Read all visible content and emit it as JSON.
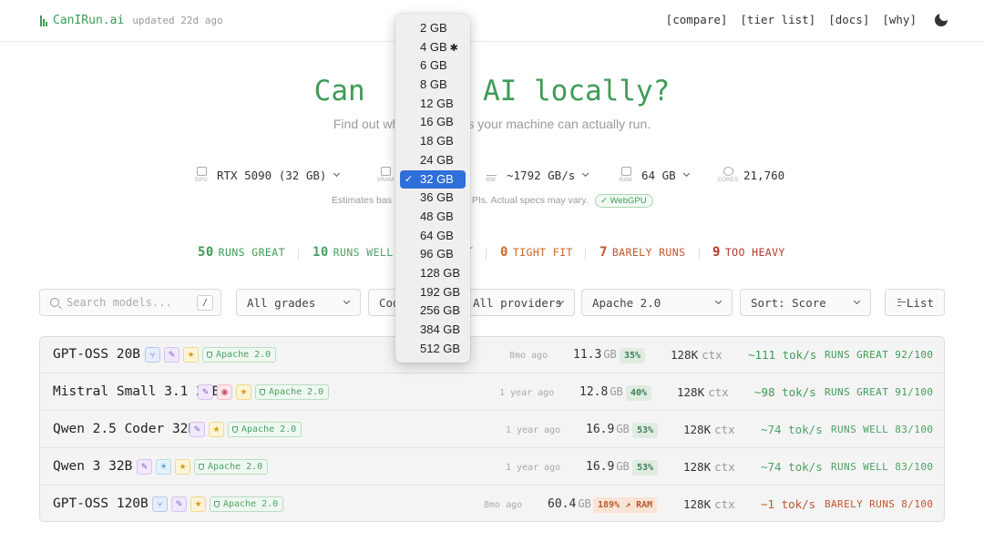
{
  "header": {
    "brand": "CanIRun.ai",
    "updated": "updated 22d ago",
    "nav": [
      "[compare]",
      "[tier list]",
      "[docs]",
      "[why]"
    ],
    "theme_icon": "moon-icon"
  },
  "hero": {
    "title_left": "Can",
    "title_right": "n AI locally?",
    "subtitle_left": "Find out whi",
    "subtitle_right": "s your machine can actually run."
  },
  "specs": {
    "gpu": {
      "label": "GPU",
      "value": "RTX 5090 (32 GB)"
    },
    "vram": {
      "label": "VRAM"
    },
    "bw": {
      "label": "BW",
      "value": "~1792 GB/s"
    },
    "ram": {
      "label": "RAM",
      "value": "64 GB"
    },
    "cores": {
      "label": "CORES",
      "value": "21,760"
    },
    "note_left": "Estimates bas",
    "note_right": "PIs. Actual specs may vary.",
    "webgpu": "WebGPU"
  },
  "counts": [
    {
      "num": "50",
      "label": "RUNS GREAT"
    },
    {
      "num": "10",
      "label": "RUNS WELL"
    },
    {
      "num": "",
      "label": "T"
    },
    {
      "num": "0",
      "label": "TIGHT FIT"
    },
    {
      "num": "7",
      "label": "BARELY RUNS"
    },
    {
      "num": "9",
      "label": "TOO HEAVY"
    }
  ],
  "filters": {
    "search_placeholder": "Search models...",
    "search_shortcut": "/",
    "grades": "All grades",
    "code_partial": "Cod",
    "providers": "All providers",
    "license": "Apache 2.0",
    "sort": "Sort: Score",
    "view": "List"
  },
  "models": [
    {
      "name": "GPT-OSS 20B",
      "badges": [
        "moe",
        "tool",
        "star"
      ],
      "license": "Apache 2.0",
      "age": "8mo ago",
      "size": "11.3",
      "unit": "GB",
      "pct": "35%",
      "ctx": "128K",
      "ctx_unit": "ctx",
      "speed": "~111 tok/s",
      "verdict": "RUNS GREAT 92/100"
    },
    {
      "name": "Mistral Small 3.1 24B",
      "badges": [
        "tool",
        "vision",
        "star"
      ],
      "license": "Apache 2.0",
      "age": "1 year ago",
      "size": "12.8",
      "unit": "GB",
      "pct": "40%",
      "ctx": "128K",
      "ctx_unit": "ctx",
      "speed": "~98 tok/s",
      "verdict": "RUNS GREAT 91/100"
    },
    {
      "name": "Qwen 2.5 Coder 32B",
      "badges": [
        "tool",
        "star"
      ],
      "license": "Apache 2.0",
      "age": "1 year ago",
      "size": "16.9",
      "unit": "GB",
      "pct": "53%",
      "ctx": "128K",
      "ctx_unit": "ctx",
      "speed": "~74 tok/s",
      "verdict": "RUNS WELL 83/100"
    },
    {
      "name": "Qwen 3 32B",
      "badges": [
        "tool",
        "reasoning",
        "star"
      ],
      "license": "Apache 2.0",
      "age": "1 year ago",
      "size": "16.9",
      "unit": "GB",
      "pct": "53%",
      "ctx": "128K",
      "ctx_unit": "ctx",
      "speed": "~74 tok/s",
      "verdict": "RUNS WELL 83/100"
    },
    {
      "name": "GPT-OSS 120B",
      "badges": [
        "moe",
        "tool",
        "star"
      ],
      "license": "Apache 2.0",
      "age": "8mo ago",
      "size": "60.4",
      "unit": "GB",
      "pct": "189% ↗ RAM",
      "ctx": "128K",
      "ctx_unit": "ctx",
      "speed": "~1 tok/s",
      "verdict": "BARELY RUNS 8/100"
    }
  ],
  "vram_dropdown": {
    "options": [
      "2 GB",
      "4 GB",
      "6 GB",
      "8 GB",
      "12 GB",
      "16 GB",
      "18 GB",
      "24 GB",
      "32 GB",
      "36 GB",
      "48 GB",
      "64 GB",
      "96 GB",
      "128 GB",
      "192 GB",
      "256 GB",
      "384 GB",
      "512 GB"
    ],
    "selected": "32 GB",
    "starred": "4 GB"
  },
  "colors": {
    "accent": "#3f9b57",
    "runs_great": "#3f9b57",
    "runs_well": "#4fa165",
    "tight_fit": "#c8682a",
    "barely_runs": "#c2552b",
    "too_heavy": "#b5392b",
    "dropdown_selected": "#2f6fdb"
  }
}
